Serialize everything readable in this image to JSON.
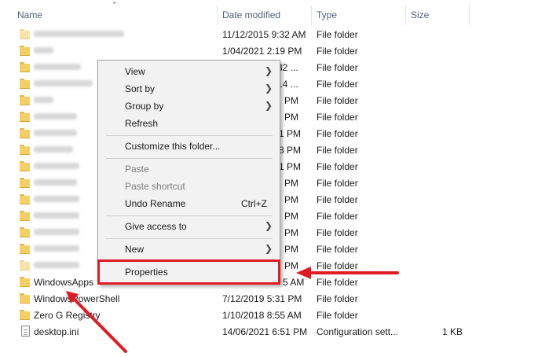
{
  "header": {
    "name": "Name",
    "date_modified": "Date modified",
    "type": "Type",
    "size": "Size"
  },
  "rows": [
    {
      "name": "",
      "date": "11/12/2015 9:32 AM",
      "type": "File folder",
      "size": ""
    },
    {
      "name": "",
      "date": "1/04/2021 2:19 PM",
      "type": "File folder",
      "size": ""
    },
    {
      "name": "",
      "date": "32 ...",
      "type": "File folder",
      "size": ""
    },
    {
      "name": "",
      "date": "14 ...",
      "type": "File folder",
      "size": ""
    },
    {
      "name": "",
      "date": "PM",
      "type": "File folder",
      "size": ""
    },
    {
      "name": "",
      "date": "PM",
      "type": "File folder",
      "size": ""
    },
    {
      "name": "",
      "date": "1 PM",
      "type": "File folder",
      "size": ""
    },
    {
      "name": "",
      "date": "8 PM",
      "type": "File folder",
      "size": ""
    },
    {
      "name": "",
      "date": "1 PM",
      "type": "File folder",
      "size": ""
    },
    {
      "name": "",
      "date": "PM",
      "type": "File folder",
      "size": ""
    },
    {
      "name": "",
      "date": "PM",
      "type": "File folder",
      "size": ""
    },
    {
      "name": "",
      "date": "PM",
      "type": "File folder",
      "size": ""
    },
    {
      "name": "",
      "date": "PM",
      "type": "File folder",
      "size": ""
    },
    {
      "name": "",
      "date": "PM",
      "type": "File folder",
      "size": ""
    },
    {
      "name": "",
      "date": "PM",
      "type": "File folder",
      "size": ""
    },
    {
      "name": "WindowsApps",
      "date": "5 AM",
      "type": "File folder",
      "size": ""
    },
    {
      "name": "WindowsPowerShell",
      "date": "7/12/2019 5:31 PM",
      "type": "File folder",
      "size": ""
    },
    {
      "name": "Zero G Registry",
      "date": "1/10/2018 8:55 AM",
      "type": "File folder",
      "size": ""
    },
    {
      "name": "desktop.ini",
      "date": "14/06/2021 6:51 PM",
      "type": "Configuration sett...",
      "size": "1 KB"
    }
  ],
  "context_menu": {
    "view": "View",
    "sort_by": "Sort by",
    "group_by": "Group by",
    "refresh": "Refresh",
    "customize": "Customize this folder...",
    "paste": "Paste",
    "paste_shortcut": "Paste shortcut",
    "undo_rename": "Undo Rename",
    "undo_shortcut": "Ctrl+Z",
    "give_access": "Give access to",
    "new": "New",
    "properties": "Properties"
  },
  "colors": {
    "highlight": "#e01b24",
    "folder": "#f4cf66",
    "header_text": "#4c607a"
  }
}
